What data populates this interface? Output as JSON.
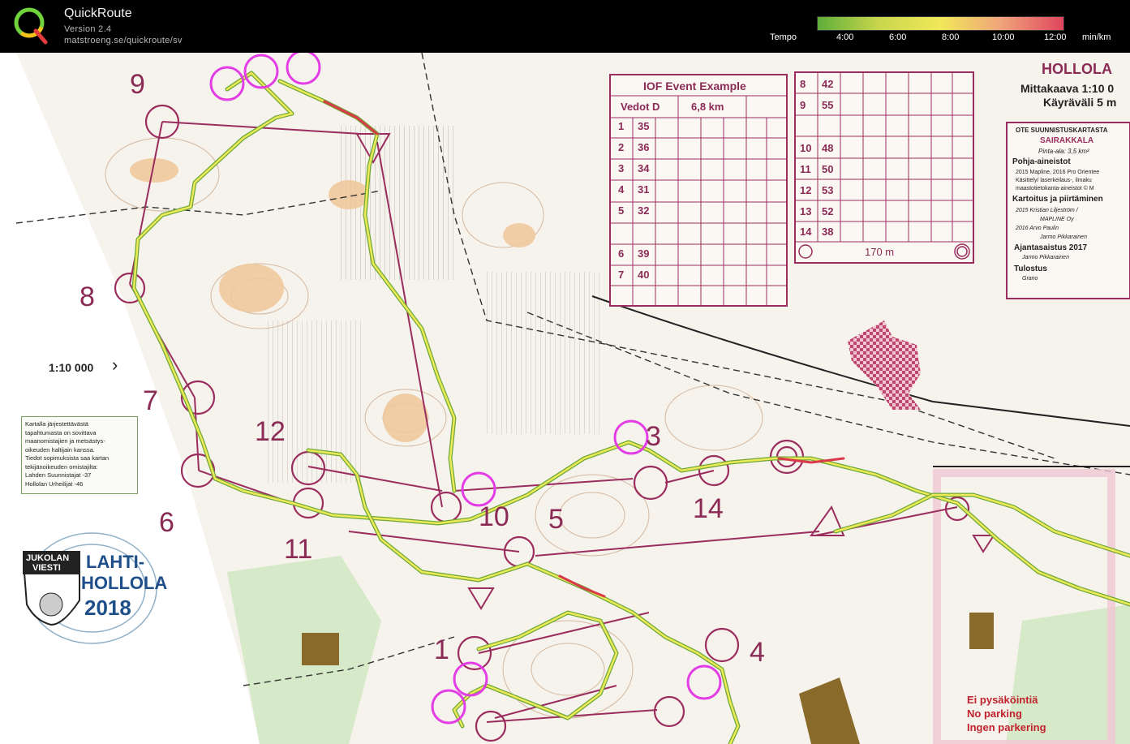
{
  "app": {
    "title": "QuickRoute",
    "version": "Version 2.4",
    "url": "matstroeng.se/quickroute/sv"
  },
  "tempo_legend": {
    "label": "Tempo",
    "ticks": [
      "4:00",
      "6:00",
      "8:00",
      "10:00",
      "12:00"
    ],
    "unit": "min/km",
    "colors": [
      "#5fae3a",
      "#c9d64c",
      "#f1e85a",
      "#f0a27a",
      "#e0455e"
    ]
  },
  "map": {
    "area_name": "HOLLOLA",
    "scale_line": "Mittakaava 1:10 0",
    "interval_line": "Käyräväli 5 m",
    "scale_label": "1:10 000",
    "control_numbers": [
      "1",
      "3",
      "4",
      "5",
      "6",
      "7",
      "8",
      "9",
      "10",
      "11",
      "12",
      "14"
    ],
    "colors": {
      "course": "#9b2d5e",
      "route_good": "#3b8f2a",
      "route_mid": "#e9e64a",
      "route_slow": "#d83a4a",
      "highlight": "#e33de6"
    }
  },
  "description_table": {
    "title": "IOF Event Example",
    "class": "Vedot D",
    "length": "6,8 km",
    "rows_left": [
      {
        "n": "1",
        "code": "35"
      },
      {
        "n": "2",
        "code": "36"
      },
      {
        "n": "3",
        "code": "34"
      },
      {
        "n": "4",
        "code": "31"
      },
      {
        "n": "5",
        "code": "32"
      },
      {
        "n": "6",
        "code": "39"
      },
      {
        "n": "7",
        "code": "40"
      }
    ],
    "rows_right": [
      {
        "n": "8",
        "code": "42"
      },
      {
        "n": "9",
        "code": "55"
      },
      {
        "n": "10",
        "code": "48"
      },
      {
        "n": "11",
        "code": "50"
      },
      {
        "n": "12",
        "code": "53"
      },
      {
        "n": "13",
        "code": "52"
      },
      {
        "n": "14",
        "code": "38"
      }
    ],
    "finish_distance": "170 m"
  },
  "info_box": {
    "header": "OTE SUUNNISTUSKARTASTA",
    "name": "SAIRAKKALA",
    "area": "Pinta-ala: 3,5 km²",
    "base_title": "Pohja-aineistot",
    "base_lines": [
      "2015 Mapline, 2016 Pro Orientee",
      "Käsittely/   laserkeilaus-, ilmaku",
      "maastotietokanta-aineistot   © M"
    ],
    "mapping_title": "Kartoitus ja piirtäminen",
    "mapping_lines": [
      "2015  Kristian Liljeström /",
      "MAPLINE Oy",
      "2016  Arvo Paulin",
      "Jarmo Pikkarainen"
    ],
    "update_title": "Ajantasaistus 2017",
    "update_line": "Jarmo Pikkarainen",
    "print_title": "Tulostus",
    "print_line": "Grano"
  },
  "notice": {
    "lines": [
      "Kartalla järjestettävästä",
      "tapahtumasta on sovittava",
      "maanomistajien ja metsästys-",
      "oikeuden haltijain kanssa.",
      "Tiedot sopimuksista saa kartan",
      "tekijänoikeuden omistajilta:",
      "Lahden Suunnistajat -37",
      "Hollolan Urheilijat -46"
    ]
  },
  "event_logo": {
    "line1": "JUKOLAN",
    "line2": "VIESTI",
    "city1": "LAHTI-",
    "city2": "HOLLOLA",
    "year": "2018"
  },
  "parking": {
    "lines": [
      "Ei pysäköintiä",
      "No parking",
      "Ingen parkering"
    ]
  }
}
